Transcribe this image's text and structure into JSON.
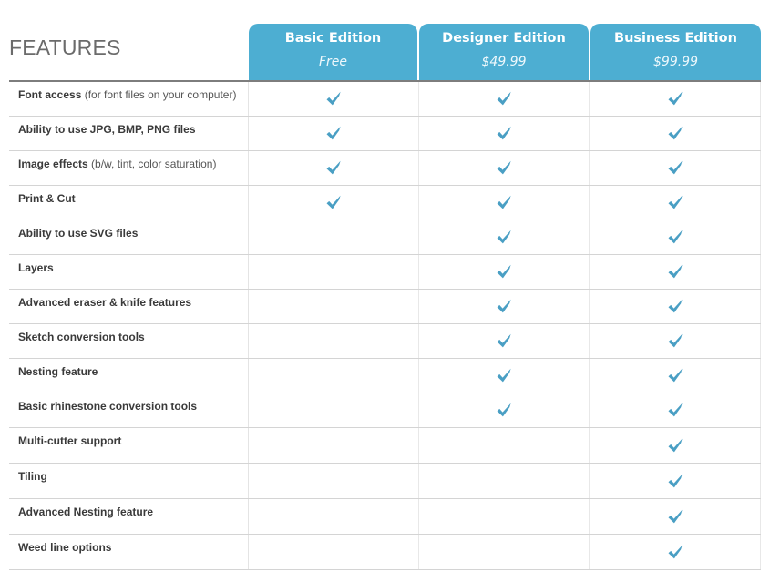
{
  "header": {
    "title": "FEATURES"
  },
  "plans": [
    {
      "name": "Basic Edition",
      "price": "Free"
    },
    {
      "name": "Designer Edition",
      "price": "$49.99"
    },
    {
      "name": "Business Edition",
      "price": "$99.99"
    }
  ],
  "colors": {
    "accent": "#4daed2",
    "check": "#4a9fc4"
  },
  "features": [
    {
      "label": "Font access",
      "note": "(for font files on your computer)",
      "included": [
        true,
        true,
        true
      ]
    },
    {
      "label": "Ability to use JPG, BMP, PNG files",
      "note": "",
      "included": [
        true,
        true,
        true
      ]
    },
    {
      "label": "Image effects",
      "note": "(b/w, tint, color saturation)",
      "included": [
        true,
        true,
        true
      ]
    },
    {
      "label": "Print & Cut",
      "note": "",
      "included": [
        true,
        true,
        true
      ]
    },
    {
      "label": "Ability to use SVG files",
      "note": "",
      "included": [
        false,
        true,
        true
      ]
    },
    {
      "label": "Layers",
      "note": "",
      "included": [
        false,
        true,
        true
      ]
    },
    {
      "label": "Advanced eraser & knife features",
      "note": "",
      "included": [
        false,
        true,
        true
      ]
    },
    {
      "label": "Sketch conversion tools",
      "note": "",
      "included": [
        false,
        true,
        true
      ]
    },
    {
      "label": "Nesting feature",
      "note": "",
      "included": [
        false,
        true,
        true
      ]
    },
    {
      "label": "Basic rhinestone conversion tools",
      "note": "",
      "included": [
        false,
        true,
        true
      ]
    },
    {
      "label": "Multi-cutter support",
      "note": "",
      "included": [
        false,
        false,
        true
      ]
    },
    {
      "label": "Tiling",
      "note": "",
      "included": [
        false,
        false,
        true
      ]
    },
    {
      "label": "Advanced Nesting feature",
      "note": "",
      "included": [
        false,
        false,
        true
      ]
    },
    {
      "label": "Weed line options",
      "note": "",
      "included": [
        false,
        false,
        true
      ]
    }
  ],
  "icons": {
    "included": "checkmark-icon"
  }
}
